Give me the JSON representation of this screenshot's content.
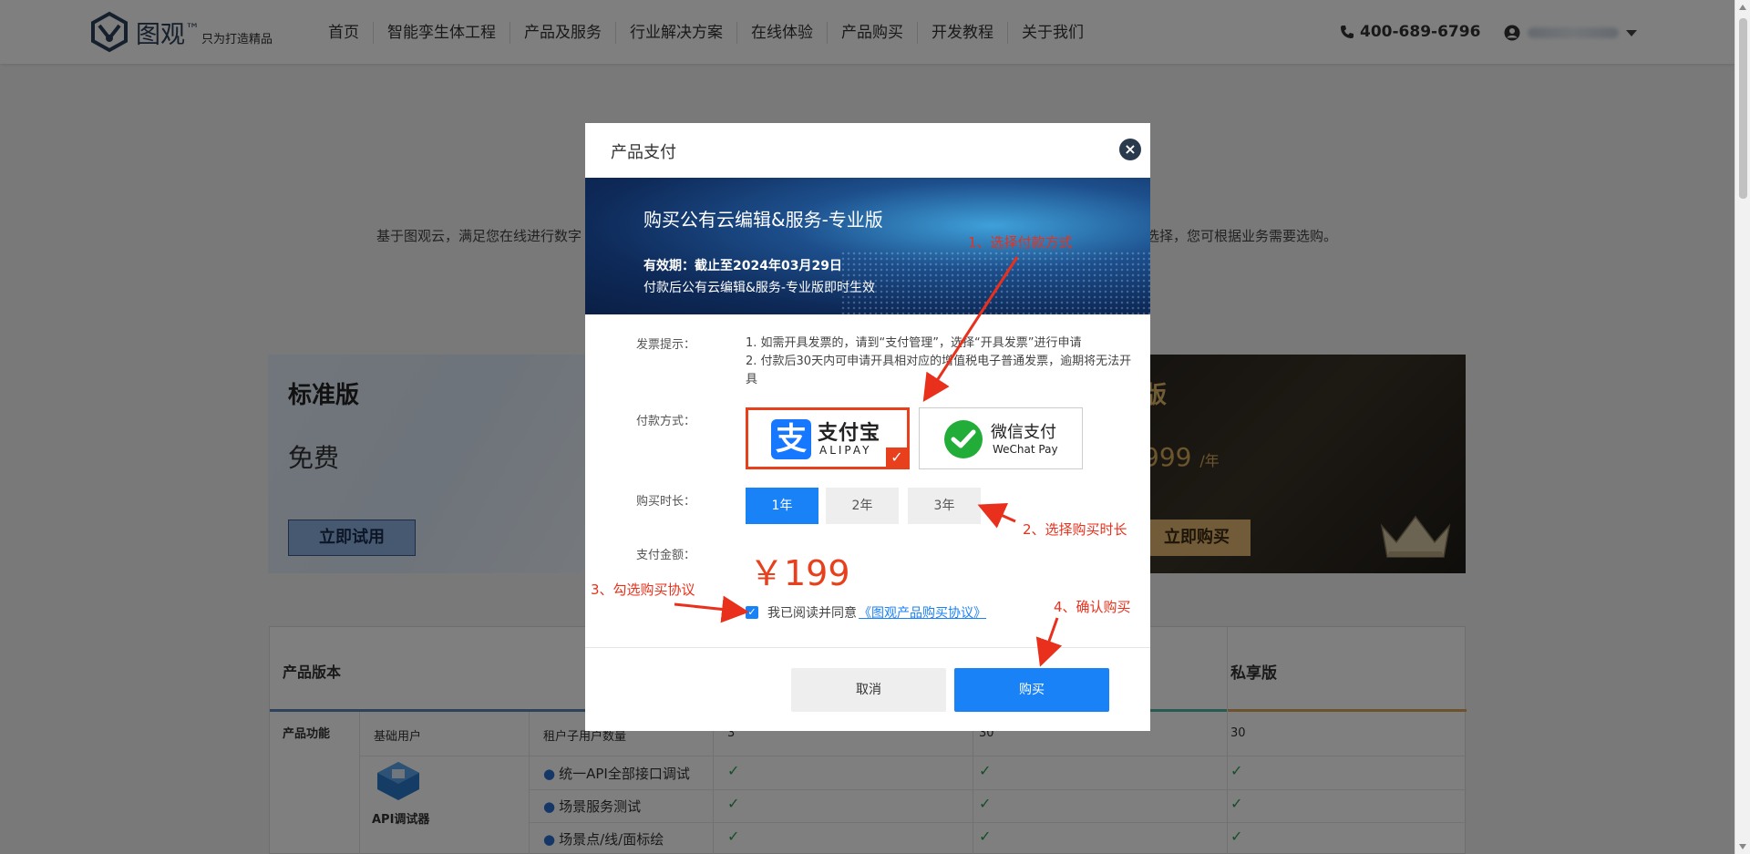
{
  "brand": {
    "name": "图观",
    "tm": "™",
    "slogan": "只为打造精品"
  },
  "nav": {
    "items": [
      {
        "label": "首页"
      },
      {
        "label": "智能孪生体工程"
      },
      {
        "label": "产品及服务"
      },
      {
        "label": "行业解决方案"
      },
      {
        "label": "在线体验"
      },
      {
        "label": "产品购买"
      },
      {
        "label": "开发教程"
      },
      {
        "label": "关于我们"
      }
    ],
    "phone": "400-689-6796"
  },
  "page": {
    "description_left": "基于图观云，满足您在线进行数字",
    "description_right": "品选择，您可根据业务需要选购。",
    "standard": {
      "title": "标准版",
      "price": "免费",
      "button": "立即试用"
    },
    "private": {
      "title": "版",
      "price": "999",
      "unit": "/年",
      "button": "立即购买"
    }
  },
  "table": {
    "header_version": "产品版本",
    "header_private": "私享版",
    "feature_group": "产品功能",
    "basic_user": "基础用户",
    "sub_users": "租户子用户数量",
    "sub_users_values": [
      "3",
      "30",
      "30"
    ],
    "api_label": "API调试器",
    "features": [
      "统一API全部接口调试",
      "场景服务测试",
      "场景点/线/面标绘"
    ],
    "check": "✓"
  },
  "modal": {
    "title": "产品支付",
    "close": "×",
    "banner": {
      "title": "购买公有云编辑&服务-专业版",
      "valid": "有效期：截止至2024年03月29日",
      "note": "付款后公有云编辑&服务-专业版即时生效"
    },
    "invoice_label": "发票提示：",
    "invoice_line1": "1. 如需开具发票的，请到“支付管理”，选择“开具发票”进行申请",
    "invoice_line2": "2. 付款后30天内可申请开具相对应的增值税电子普通发票，逾期将无法开具",
    "payment_label": "付款方式：",
    "alipay": {
      "glyph": "支",
      "name": "支付宝",
      "sub": "ALIPAY",
      "selected": true
    },
    "wechat": {
      "name": "微信支付",
      "sub": "WeChat Pay"
    },
    "duration_label": "购买时长：",
    "durations": [
      "1年",
      "2年",
      "3年"
    ],
    "selected_duration": "1年",
    "amount_label": "支付金额：",
    "amount": "￥199",
    "agree_text": "我已阅读并同意",
    "agree_link": "《图观产品购买协议》",
    "agree_checked": true,
    "cancel": "取消",
    "buy": "购买"
  },
  "annotations": {
    "step1": "1、选择付款方式",
    "step2": "2、选择购买时长",
    "step3": "3、勾选购买协议",
    "step4": "4、确认购买"
  },
  "colors": {
    "primary": "#1a82f7",
    "accent_red": "#e8401c",
    "annotation_red": "#e8301c",
    "navy": "#2d3e59"
  }
}
